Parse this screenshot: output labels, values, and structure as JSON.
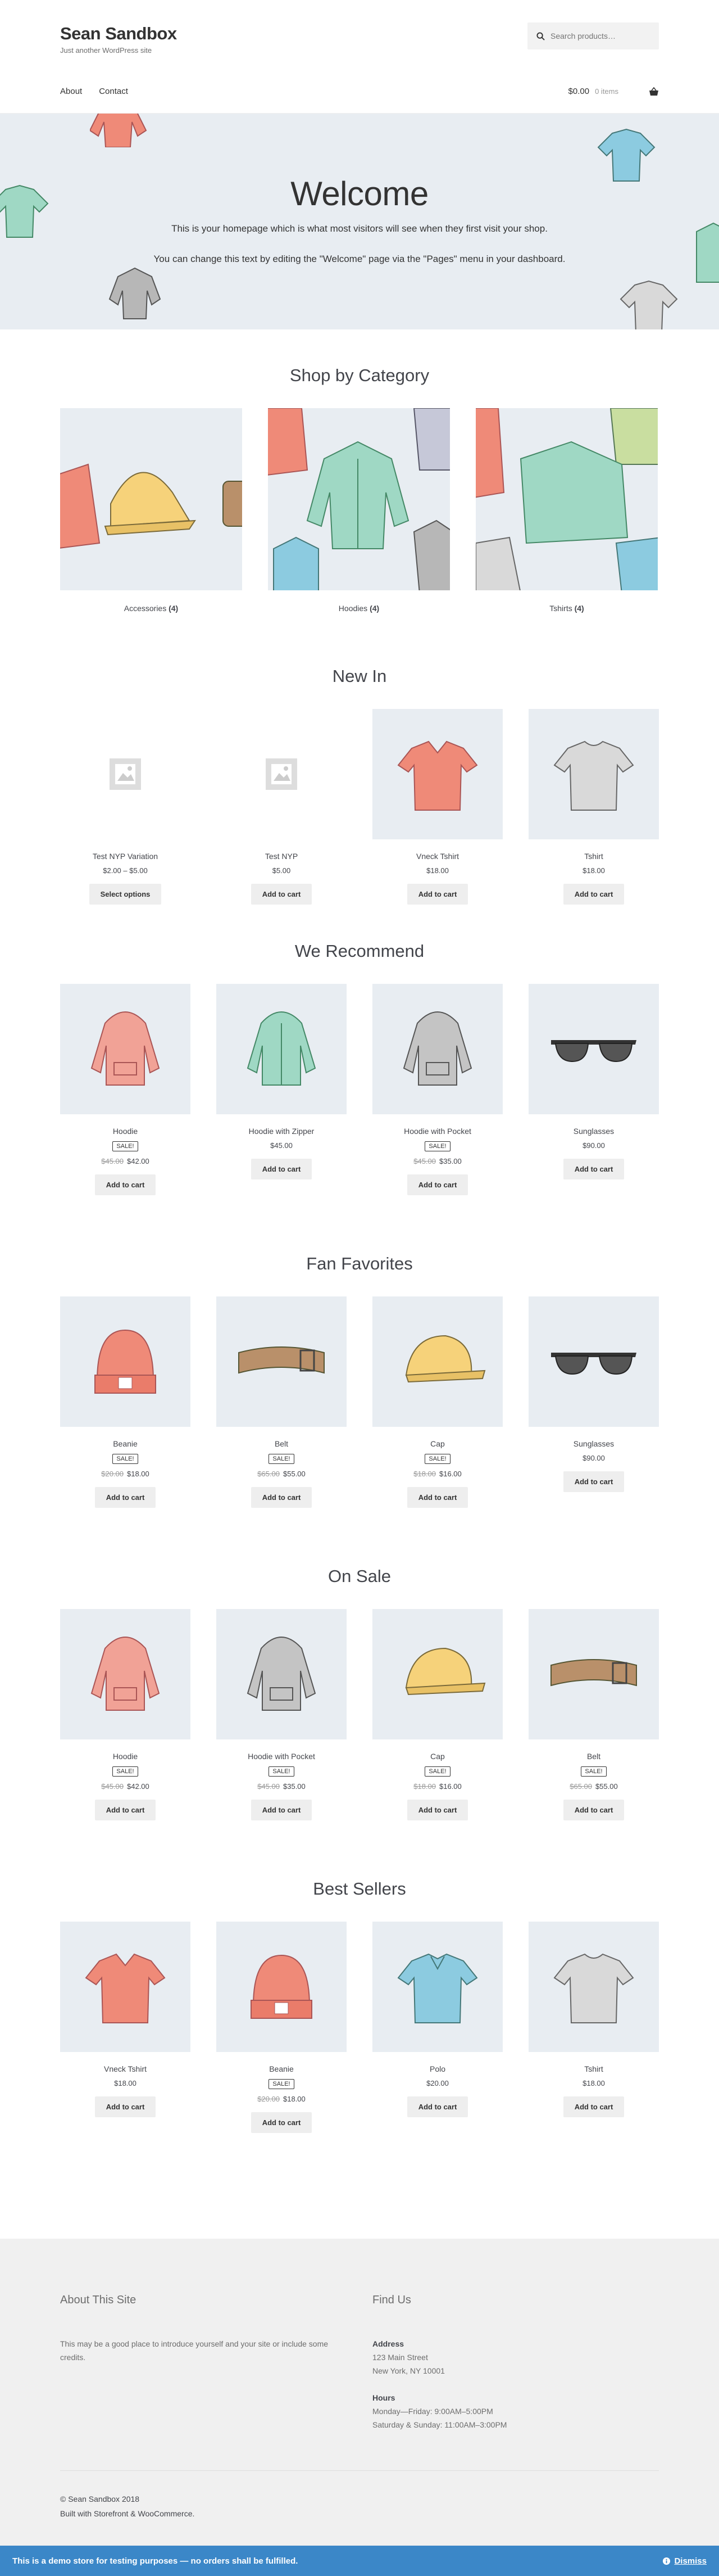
{
  "header": {
    "site_title": "Sean Sandbox",
    "site_description": "Just another WordPress site",
    "search_placeholder": "Search products…",
    "nav": [
      "About",
      "Contact"
    ],
    "cart_amount": "$0.00",
    "cart_count": "0 items"
  },
  "hero": {
    "title": "Welcome",
    "line1": "This is your homepage which is what most visitors will see when they first visit your shop.",
    "line2": "You can change this text by editing the \"Welcome\" page via the \"Pages\" menu in your dashboard."
  },
  "categories": {
    "heading": "Shop by Category",
    "items": [
      {
        "name": "Accessories",
        "count": "(4)"
      },
      {
        "name": "Hoodies",
        "count": "(4)"
      },
      {
        "name": "Tshirts",
        "count": "(4)"
      }
    ]
  },
  "new_in": {
    "heading": "New In",
    "items": [
      {
        "title": "Test NYP Variation",
        "price": "$2.00 – $5.00",
        "button": "Select options",
        "image": "placeholder-icon"
      },
      {
        "title": "Test NYP",
        "price": "$5.00",
        "button": "Add to cart",
        "image": "placeholder-icon"
      },
      {
        "title": "Vneck Tshirt",
        "price": "$18.00",
        "button": "Add to cart",
        "image": "vneck-icon"
      },
      {
        "title": "Tshirt",
        "price": "$18.00",
        "button": "Add to cart",
        "image": "tshirt-icon"
      }
    ]
  },
  "recommend": {
    "heading": "We Recommend",
    "items": [
      {
        "title": "Hoodie",
        "sale": "SALE!",
        "old_price": "$45.00",
        "price": "$42.00",
        "button": "Add to cart",
        "image": "hoodie-pink-icon"
      },
      {
        "title": "Hoodie with Zipper",
        "price": "$45.00",
        "button": "Add to cart",
        "image": "hoodie-green-icon"
      },
      {
        "title": "Hoodie with Pocket",
        "sale": "SALE!",
        "old_price": "$45.00",
        "price": "$35.00",
        "button": "Add to cart",
        "image": "hoodie-grey-icon"
      },
      {
        "title": "Sunglasses",
        "price": "$90.00",
        "button": "Add to cart",
        "image": "sunglasses-icon"
      }
    ]
  },
  "fan": {
    "heading": "Fan Favorites",
    "items": [
      {
        "title": "Beanie",
        "sale": "SALE!",
        "old_price": "$20.00",
        "price": "$18.00",
        "button": "Add to cart",
        "image": "beanie-icon"
      },
      {
        "title": "Belt",
        "sale": "SALE!",
        "old_price": "$65.00",
        "price": "$55.00",
        "button": "Add to cart",
        "image": "belt-icon"
      },
      {
        "title": "Cap",
        "sale": "SALE!",
        "old_price": "$18.00",
        "price": "$16.00",
        "button": "Add to cart",
        "image": "cap-icon"
      },
      {
        "title": "Sunglasses",
        "price": "$90.00",
        "button": "Add to cart",
        "image": "sunglasses-icon"
      }
    ]
  },
  "onsale": {
    "heading": "On Sale",
    "items": [
      {
        "title": "Hoodie",
        "sale": "SALE!",
        "old_price": "$45.00",
        "price": "$42.00",
        "button": "Add to cart",
        "image": "hoodie-pink-icon"
      },
      {
        "title": "Hoodie with Pocket",
        "sale": "SALE!",
        "old_price": "$45.00",
        "price": "$35.00",
        "button": "Add to cart",
        "image": "hoodie-grey-icon"
      },
      {
        "title": "Cap",
        "sale": "SALE!",
        "old_price": "$18.00",
        "price": "$16.00",
        "button": "Add to cart",
        "image": "cap-icon"
      },
      {
        "title": "Belt",
        "sale": "SALE!",
        "old_price": "$65.00",
        "price": "$55.00",
        "button": "Add to cart",
        "image": "belt-icon"
      }
    ]
  },
  "best": {
    "heading": "Best Sellers",
    "items": [
      {
        "title": "Vneck Tshirt",
        "price": "$18.00",
        "button": "Add to cart",
        "image": "vneck-icon"
      },
      {
        "title": "Beanie",
        "sale": "SALE!",
        "old_price": "$20.00",
        "price": "$18.00",
        "button": "Add to cart",
        "image": "beanie-icon"
      },
      {
        "title": "Polo",
        "price": "$20.00",
        "button": "Add to cart",
        "image": "polo-icon"
      },
      {
        "title": "Tshirt",
        "price": "$18.00",
        "button": "Add to cart",
        "image": "tshirt-icon"
      }
    ]
  },
  "footer": {
    "about_title": "About This Site",
    "about_text": "This may be a good place to introduce yourself and your site or include some credits.",
    "find_title": "Find Us",
    "address_label": "Address",
    "address_line1": "123 Main Street",
    "address_line2": "New York, NY 10001",
    "hours_label": "Hours",
    "hours_line1": "Monday—Friday: 9:00AM–5:00PM",
    "hours_line2": "Saturday & Sunday: 11:00AM–3:00PM",
    "copyright": "© Sean Sandbox 2018",
    "built_with": "Built with Storefront & WooCommerce."
  },
  "notice": {
    "text": "This is a demo store for testing purposes — no orders shall be fulfilled.",
    "dismiss": "Dismiss"
  },
  "colors": {
    "accent": "#3b87c8",
    "tile_bg": "#e8edf2",
    "button_bg": "#eeeeee"
  }
}
